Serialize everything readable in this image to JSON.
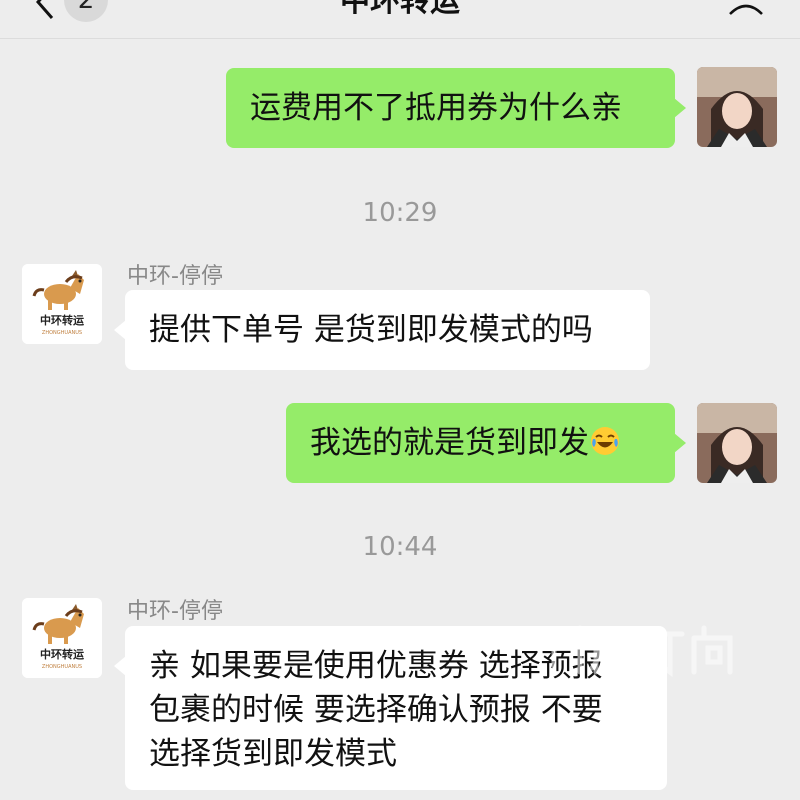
{
  "header": {
    "title": "中环转运",
    "unread_badge": "2"
  },
  "messages": [
    {
      "side": "me",
      "text": "运费用不了抵用券为什么亲"
    },
    {
      "timestamp": "10:29"
    },
    {
      "side": "them",
      "sender": "中环-停停",
      "text": "提供下单号 是货到即发模式的吗"
    },
    {
      "side": "me",
      "text": "我选的就是货到即发",
      "emoji": "crying-laughing-emoji"
    },
    {
      "timestamp": "10:44"
    },
    {
      "side": "them",
      "sender": "中环-停停",
      "lines": [
        "亲  如果要是使用优惠券 选择预报",
        "包裹的时候 要选择确认预报 不要",
        "选择货到即发模式"
      ]
    }
  ],
  "shop_avatar": {
    "brand_text": "中环转运",
    "brand_subtext": "ZHONGHUANUS"
  },
  "colors": {
    "background": "#ededed",
    "my_bubble": "#95ec69",
    "their_bubble": "#ffffff",
    "timestamp": "#999999"
  }
}
